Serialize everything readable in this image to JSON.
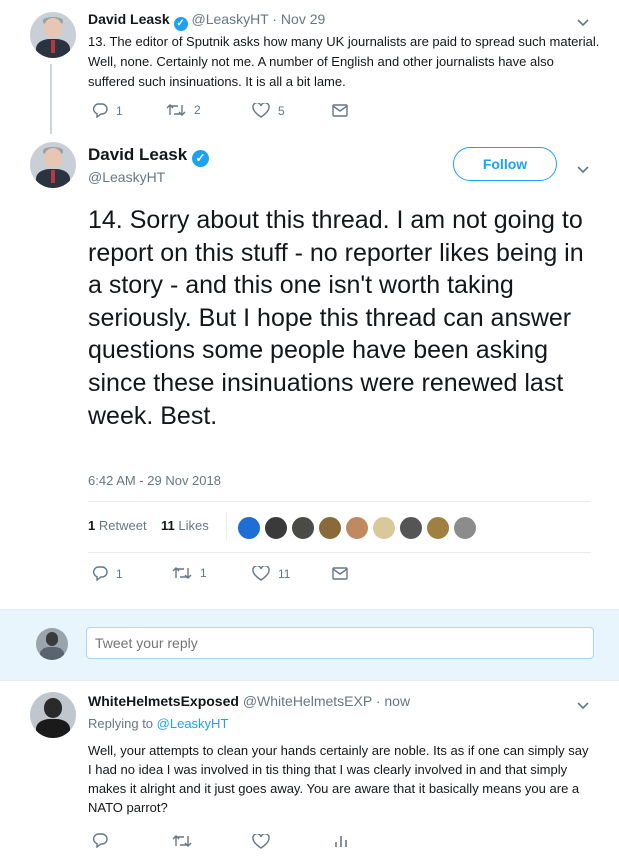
{
  "tweet13": {
    "author_name": "David Leask",
    "meta": "@LeaskyHT · Nov 29",
    "text": "13. The editor of Sputnik asks how many UK journalists are paid to spread such material. Well, none. Certainly not me. A number of English and other journalists have also suffered such insinuations. It is all a bit lame.",
    "reply_count": "1",
    "retweet_count": "2",
    "like_count": "5"
  },
  "main_tweet": {
    "author_name": "David Leask",
    "handle": "@LeaskyHT",
    "follow_label": "Follow",
    "text": "14. Sorry about this thread. I am not going to report on this stuff - no reporter likes being in a story - and this one isn't worth taking seriously. But I hope this thread can answer questions some people have been asking since these insinuations were renewed last week. Best.",
    "timestamp": "6:42 AM - 29 Nov 2018",
    "retweets_num": "1",
    "retweets_label": "Retweet",
    "likes_num": "11",
    "likes_label": "Likes",
    "reply_count": "1",
    "retweet_count": "1",
    "like_count": "11"
  },
  "reply_box": {
    "placeholder": "Tweet your reply"
  },
  "reply_tweet": {
    "author_name": "WhiteHelmetsExposed",
    "meta": "@WhiteHelmetsEXP · now",
    "replying_prefix": "Replying to",
    "replying_handle": "@LeaskyHT",
    "text": "Well, your attempts to clean your hands certainly are noble. Its as if one can simply say I had no idea I was involved in tis thing that I was clearly involved in and that simply makes it alright and it just goes away. You are aware that it basically means you are a NATO parrot?"
  },
  "colors": {
    "accent": "#1da1f2",
    "text": "#14171a",
    "secondary": "#657786",
    "border": "#e6ecf0"
  },
  "icons": [
    "verified-badge-icon",
    "chevron-down-icon",
    "reply-icon",
    "retweet-icon",
    "like-icon",
    "message-icon",
    "stats-icon"
  ]
}
